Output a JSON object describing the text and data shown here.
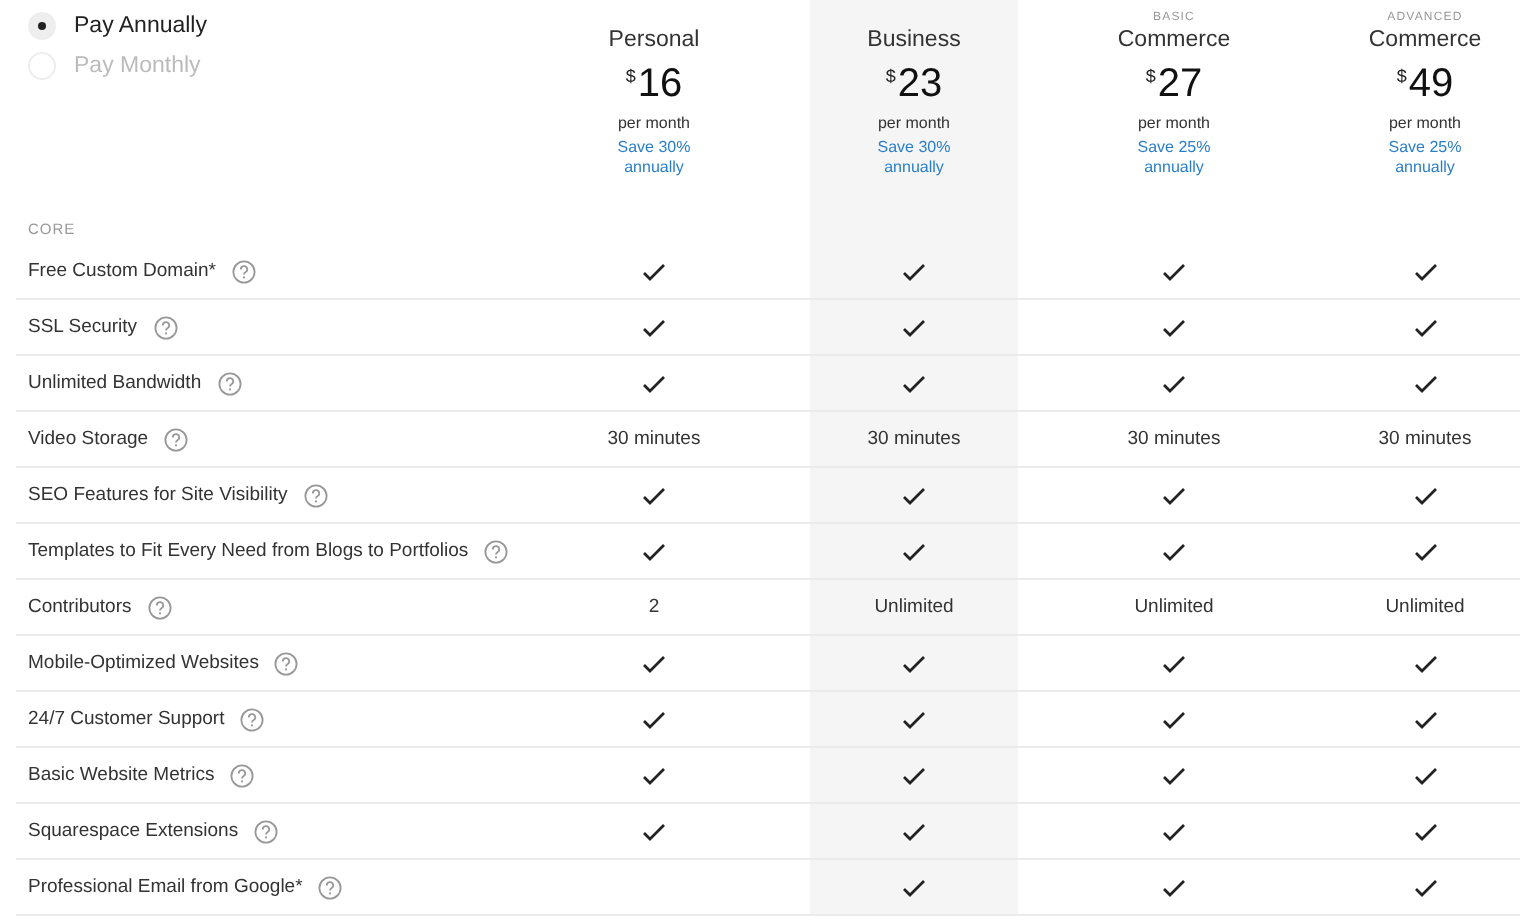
{
  "billing": [
    {
      "label": "Pay Annually",
      "selected": true
    },
    {
      "label": "Pay Monthly",
      "selected": false
    }
  ],
  "plans": [
    {
      "name": "Personal",
      "currency": "$",
      "price": "16",
      "period": "per month",
      "savings": "Save 30% annually"
    },
    {
      "name": "Business",
      "currency": "$",
      "price": "23",
      "period": "per month",
      "savings": "Save 30% annually",
      "highlighted": true
    },
    {
      "tier": "BASIC",
      "name": "Commerce",
      "currency": "$",
      "price": "27",
      "period": "per month",
      "savings": "Save 25% annually"
    },
    {
      "tier": "ADVANCED",
      "name": "Commerce",
      "currency": "$",
      "price": "49",
      "period": "per month",
      "savings": "Save 25% annually"
    }
  ],
  "section": "CORE",
  "features": [
    {
      "name": "Free Custom Domain*",
      "values": [
        {
          "kind": "check"
        },
        {
          "kind": "check"
        },
        {
          "kind": "check"
        },
        {
          "kind": "check"
        }
      ]
    },
    {
      "name": "SSL Security",
      "values": [
        {
          "kind": "check"
        },
        {
          "kind": "check"
        },
        {
          "kind": "check"
        },
        {
          "kind": "check"
        }
      ]
    },
    {
      "name": "Unlimited Bandwidth",
      "values": [
        {
          "kind": "check"
        },
        {
          "kind": "check"
        },
        {
          "kind": "check"
        },
        {
          "kind": "check"
        }
      ]
    },
    {
      "name": "Video Storage",
      "values": [
        {
          "kind": "text",
          "text": "30 minutes"
        },
        {
          "kind": "text",
          "text": "30 minutes"
        },
        {
          "kind": "text",
          "text": "30 minutes"
        },
        {
          "kind": "text",
          "text": "30 minutes"
        }
      ]
    },
    {
      "name": "SEO Features for Site Visibility",
      "values": [
        {
          "kind": "check"
        },
        {
          "kind": "check"
        },
        {
          "kind": "check"
        },
        {
          "kind": "check"
        }
      ]
    },
    {
      "name": "Templates to Fit Every Need from Blogs to Portfolios",
      "values": [
        {
          "kind": "check"
        },
        {
          "kind": "check"
        },
        {
          "kind": "check"
        },
        {
          "kind": "check"
        }
      ]
    },
    {
      "name": "Contributors",
      "values": [
        {
          "kind": "text",
          "text": "2"
        },
        {
          "kind": "text",
          "text": "Unlimited"
        },
        {
          "kind": "text",
          "text": "Unlimited"
        },
        {
          "kind": "text",
          "text": "Unlimited"
        }
      ]
    },
    {
      "name": "Mobile-Optimized Websites",
      "values": [
        {
          "kind": "check"
        },
        {
          "kind": "check"
        },
        {
          "kind": "check"
        },
        {
          "kind": "check"
        }
      ]
    },
    {
      "name": "24/7 Customer Support",
      "values": [
        {
          "kind": "check"
        },
        {
          "kind": "check"
        },
        {
          "kind": "check"
        },
        {
          "kind": "check"
        }
      ]
    },
    {
      "name": "Basic Website Metrics",
      "values": [
        {
          "kind": "check"
        },
        {
          "kind": "check"
        },
        {
          "kind": "check"
        },
        {
          "kind": "check"
        }
      ]
    },
    {
      "name": "Squarespace Extensions",
      "values": [
        {
          "kind": "check"
        },
        {
          "kind": "check"
        },
        {
          "kind": "check"
        },
        {
          "kind": "check"
        }
      ]
    },
    {
      "name": "Professional Email from Google*",
      "values": [
        {
          "kind": "none"
        },
        {
          "kind": "check"
        },
        {
          "kind": "check"
        },
        {
          "kind": "check"
        }
      ]
    }
  ]
}
